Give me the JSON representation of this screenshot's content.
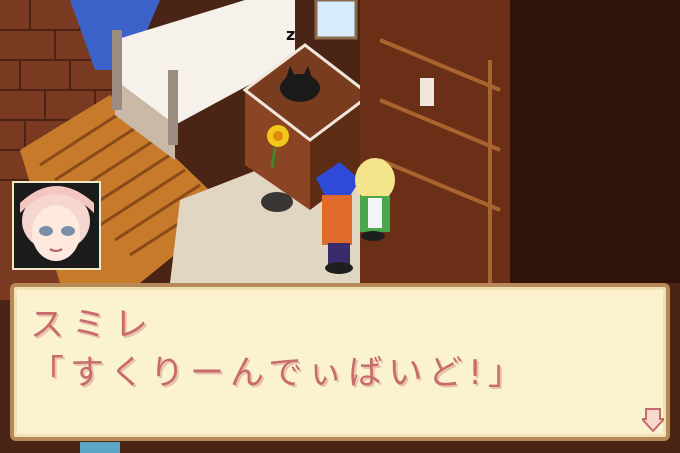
{
  "dialog": {
    "speaker": "スミレ",
    "text": "「すくりーんでぃばいど!」"
  },
  "icons": {
    "sleep": "zzz-sleep-icon",
    "next": "down-arrow-icon"
  }
}
